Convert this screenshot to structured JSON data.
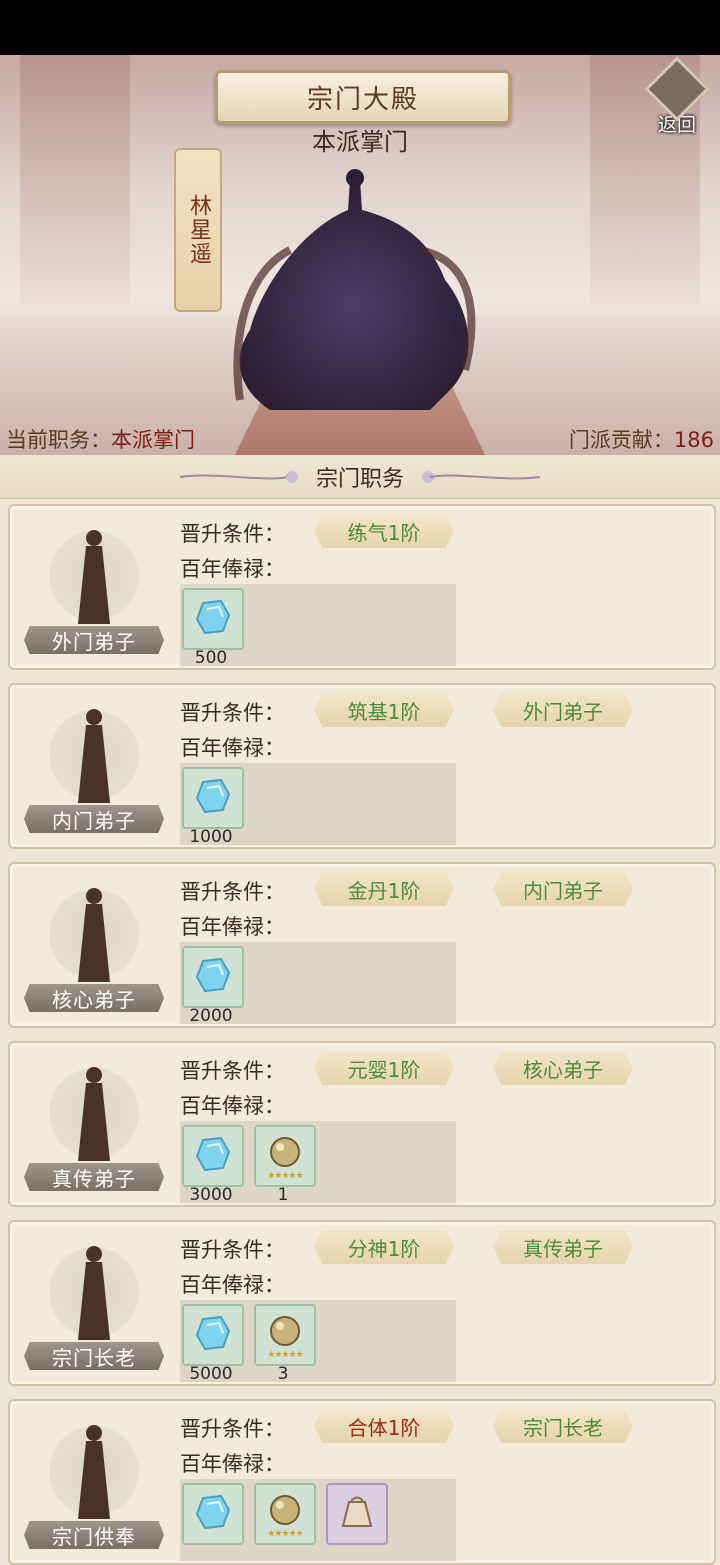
{
  "header": {
    "title": "宗门大殿",
    "back_label": "返回",
    "position_title": "本派掌门",
    "master_name": "林星遥"
  },
  "status": {
    "role_key": "当前职务：",
    "role_value": "本派掌门",
    "contrib_key": "门派贡献：",
    "contrib_value": "186"
  },
  "section": {
    "title": "宗门职务"
  },
  "labels": {
    "requirement": "晋升条件：",
    "salary": "百年俸禄："
  },
  "ranks": [
    {
      "name": "外门弟子",
      "req_realm": "练气1阶",
      "req_rank": "",
      "rewards": [
        {
          "icon": "spirit-stone-icon",
          "qty": "500"
        }
      ]
    },
    {
      "name": "内门弟子",
      "req_realm": "筑基1阶",
      "req_rank": "外门弟子",
      "rewards": [
        {
          "icon": "spirit-stone-icon",
          "qty": "1000"
        }
      ]
    },
    {
      "name": "核心弟子",
      "req_realm": "金丹1阶",
      "req_rank": "内门弟子",
      "rewards": [
        {
          "icon": "spirit-stone-icon",
          "qty": "2000"
        }
      ]
    },
    {
      "name": "真传弟子",
      "req_realm": "元婴1阶",
      "req_rank": "核心弟子",
      "rewards": [
        {
          "icon": "spirit-stone-icon",
          "qty": "3000"
        },
        {
          "icon": "golden-pill-icon",
          "qty": "1"
        }
      ]
    },
    {
      "name": "宗门长老",
      "req_realm": "分神1阶",
      "req_rank": "真传弟子",
      "rewards": [
        {
          "icon": "spirit-stone-icon",
          "qty": "5000"
        },
        {
          "icon": "golden-pill-icon",
          "qty": "3"
        }
      ]
    },
    {
      "name": "宗门供奉",
      "req_realm": "合体1阶",
      "req_rank": "宗门长老",
      "req_realm_color": "#9b2a1a",
      "rewards": [
        {
          "icon": "spirit-stone-icon",
          "qty": ""
        },
        {
          "icon": "golden-pill-icon",
          "qty": ""
        },
        {
          "icon": "talisman-bag-icon",
          "qty": ""
        }
      ]
    }
  ]
}
